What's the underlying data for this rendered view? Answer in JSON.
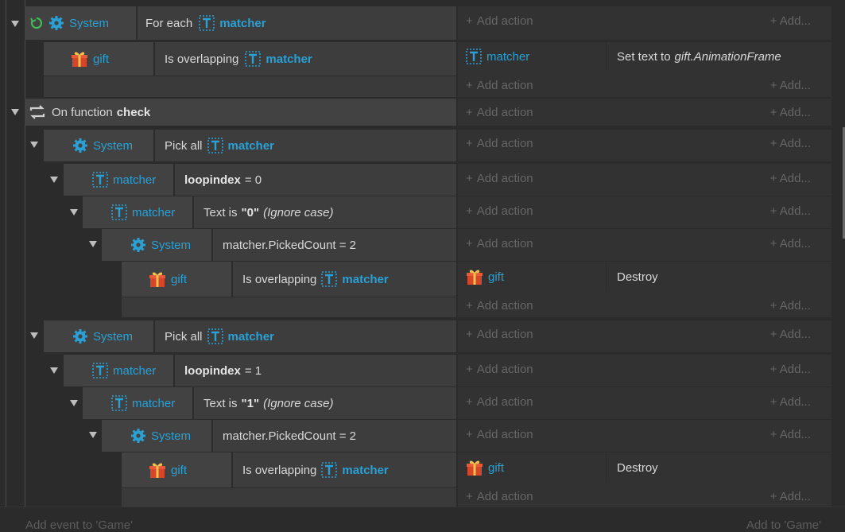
{
  "add_action": "Add action",
  "add_short": "Add...",
  "events": {
    "for_each": {
      "object": "System",
      "condition_prefix": "For each",
      "condition_object": "matcher"
    },
    "overlap1": {
      "object": "gift",
      "condition_prefix": "Is overlapping",
      "condition_object": "matcher",
      "action_object": "matcher",
      "action_prefix": "Set text to",
      "action_expr": "gift.AnimationFrame"
    },
    "function": {
      "prefix": "On function",
      "name": "check"
    },
    "pick1": {
      "object": "System",
      "condition_prefix": "Pick all",
      "condition_object": "matcher"
    },
    "loop0": {
      "object": "matcher",
      "var": "loopindex",
      "rest": "= 0"
    },
    "text0": {
      "object": "matcher",
      "prefix": "Text is",
      "value": "\"0\"",
      "suffix": "(Ignore case)"
    },
    "picked0": {
      "object": "System",
      "condition": "matcher.PickedCount = 2"
    },
    "overlap2": {
      "object": "gift",
      "condition_prefix": "Is overlapping",
      "condition_object": "matcher",
      "action_object": "gift",
      "action": "Destroy"
    },
    "pick2": {
      "object": "System",
      "condition_prefix": "Pick all",
      "condition_object": "matcher"
    },
    "loop1": {
      "object": "matcher",
      "var": "loopindex",
      "rest": "= 1"
    },
    "text1": {
      "object": "matcher",
      "prefix": "Text is",
      "value": "\"1\"",
      "suffix": "(Ignore case)"
    },
    "picked1": {
      "object": "System",
      "condition": "matcher.PickedCount = 2"
    },
    "overlap3": {
      "object": "gift",
      "condition_prefix": "Is overlapping",
      "condition_object": "matcher",
      "action_object": "gift",
      "action": "Destroy"
    }
  },
  "footer": {
    "left": "Add event to 'Game'",
    "right": "Add to 'Game'"
  },
  "colors": {
    "accent": "#2aa0d4",
    "gift": "#d6462b",
    "loop": "#44bb55"
  },
  "icons": [
    "gear-icon",
    "gift-icon",
    "text-object-icon",
    "loop-icon",
    "function-icon",
    "plus-icon",
    "collapse-arrow-icon"
  ]
}
